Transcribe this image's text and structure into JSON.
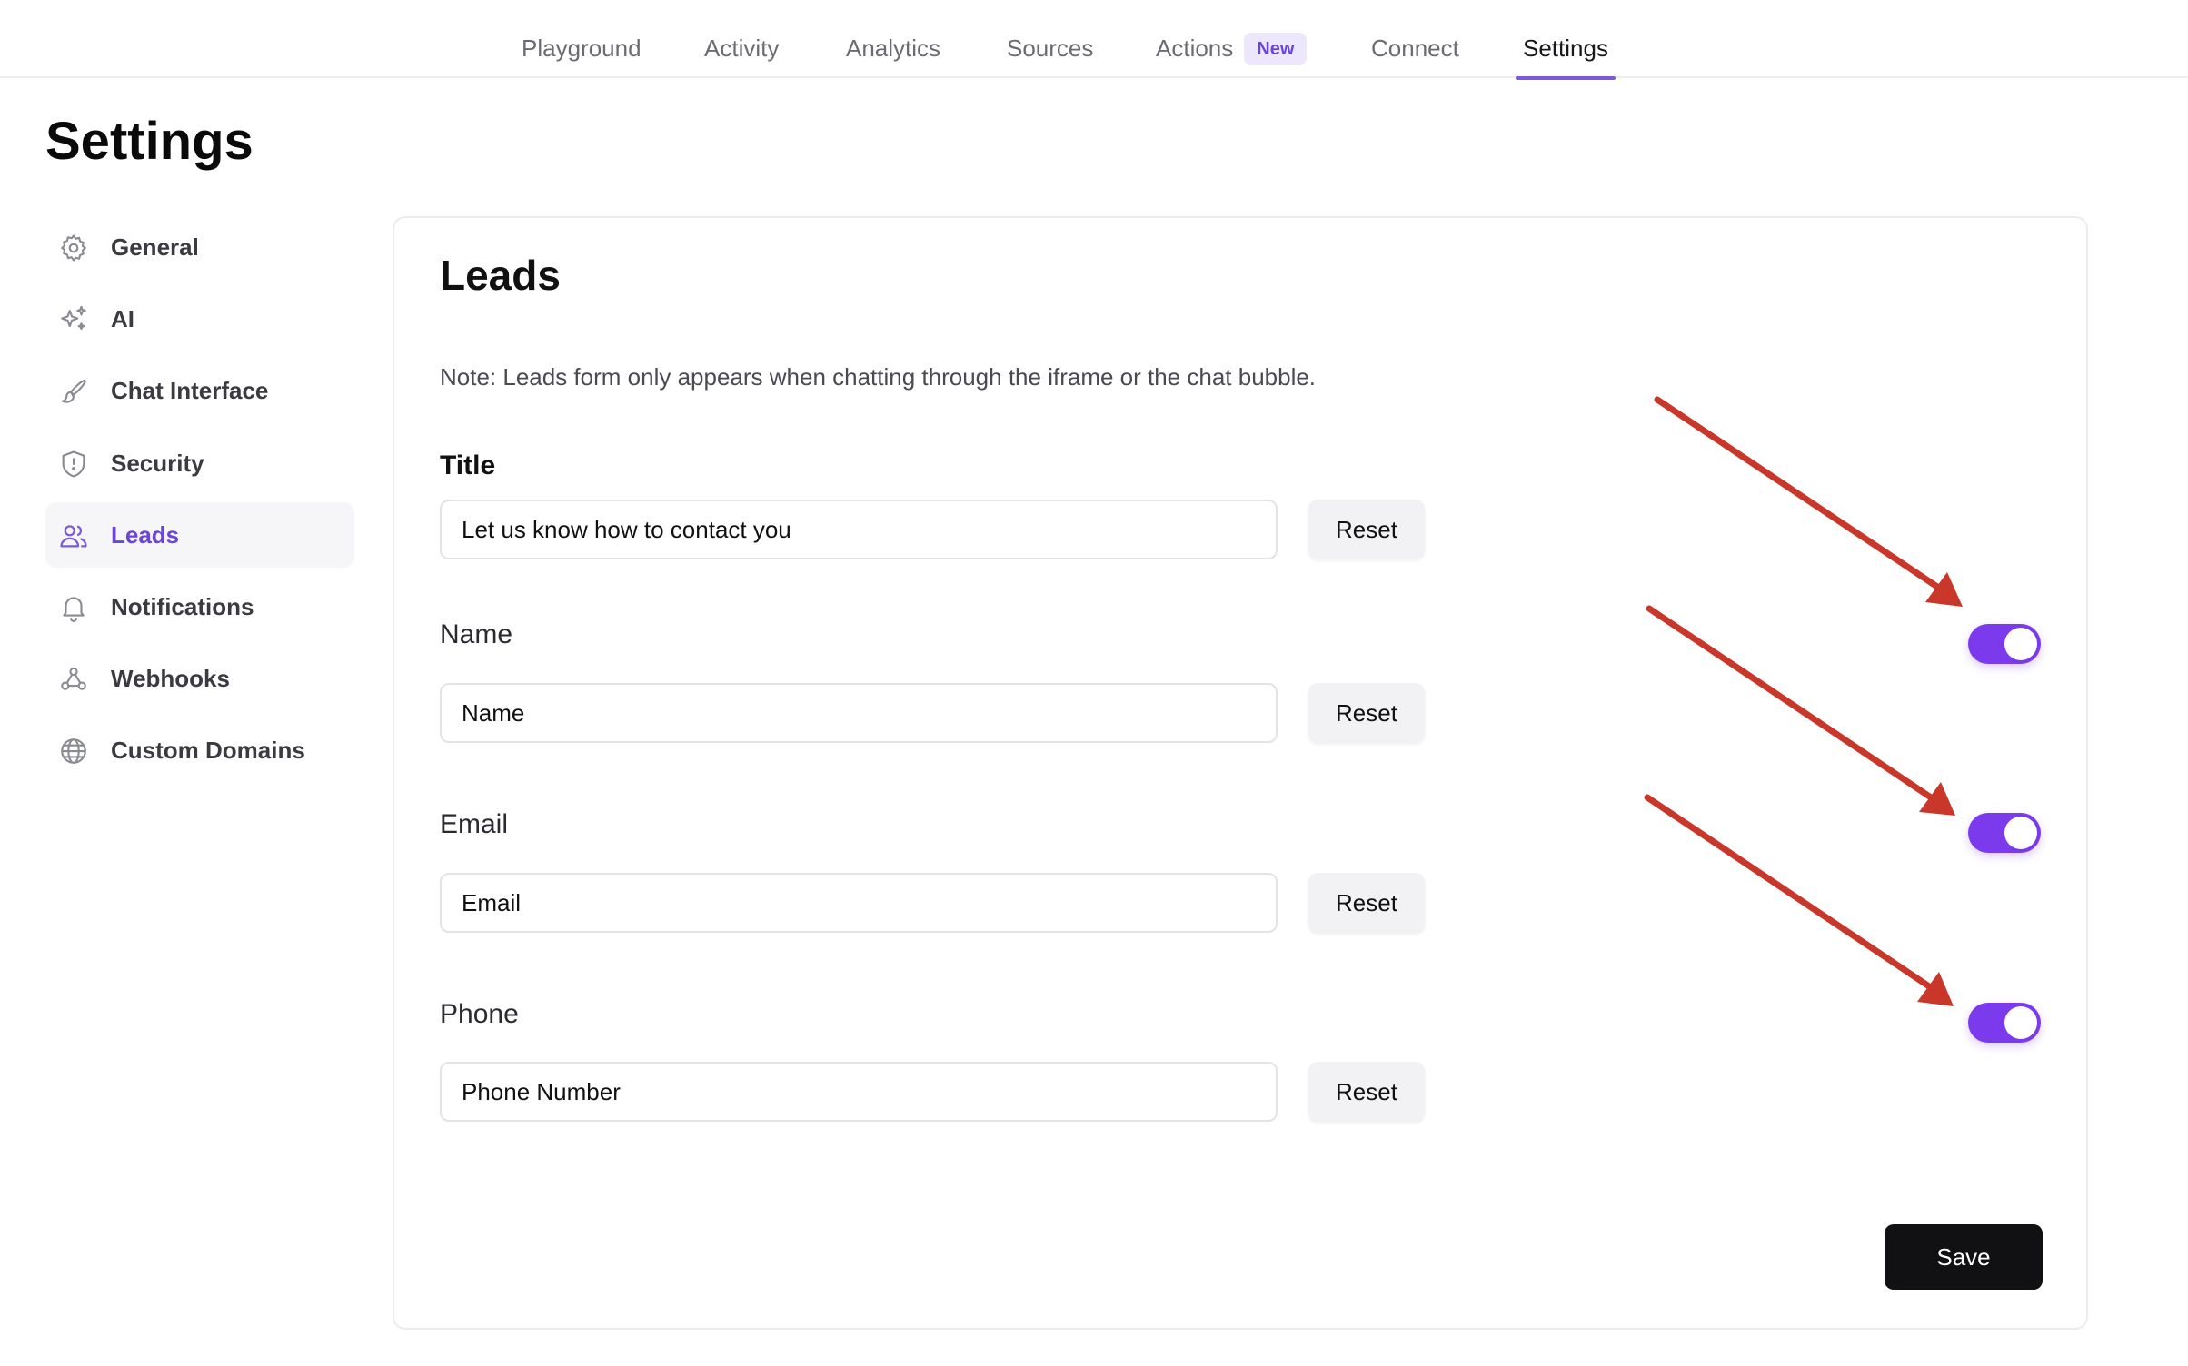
{
  "nav": {
    "tabs": [
      {
        "label": "Playground"
      },
      {
        "label": "Activity"
      },
      {
        "label": "Analytics"
      },
      {
        "label": "Sources"
      },
      {
        "label": "Actions",
        "badge": "New"
      },
      {
        "label": "Connect"
      },
      {
        "label": "Settings",
        "active": true
      }
    ]
  },
  "page": {
    "title": "Settings"
  },
  "sidebar": {
    "items": [
      {
        "label": "General",
        "icon": "gear-icon"
      },
      {
        "label": "AI",
        "icon": "sparkles-icon"
      },
      {
        "label": "Chat Interface",
        "icon": "brush-icon"
      },
      {
        "label": "Security",
        "icon": "shield-icon"
      },
      {
        "label": "Leads",
        "icon": "users-icon",
        "active": true
      },
      {
        "label": "Notifications",
        "icon": "bell-icon"
      },
      {
        "label": "Webhooks",
        "icon": "webhook-icon"
      },
      {
        "label": "Custom Domains",
        "icon": "globe-icon"
      }
    ]
  },
  "leads": {
    "title": "Leads",
    "note": "Note: Leads form only appears when chatting through the iframe or the chat bubble.",
    "fields": [
      {
        "label": "Title",
        "value": "Let us know how to contact you",
        "reset": "Reset"
      },
      {
        "label": "Name",
        "value": "Name",
        "reset": "Reset",
        "enabled": true
      },
      {
        "label": "Email",
        "value": "Email",
        "reset": "Reset",
        "enabled": true
      },
      {
        "label": "Phone",
        "value": "Phone Number",
        "reset": "Reset",
        "enabled": true
      }
    ],
    "save": "Save"
  },
  "colors": {
    "accent": "#7c3aed",
    "active_nav": "#6b45d6",
    "annotation_arrow": "#c8372a",
    "save_button": "#111113"
  }
}
